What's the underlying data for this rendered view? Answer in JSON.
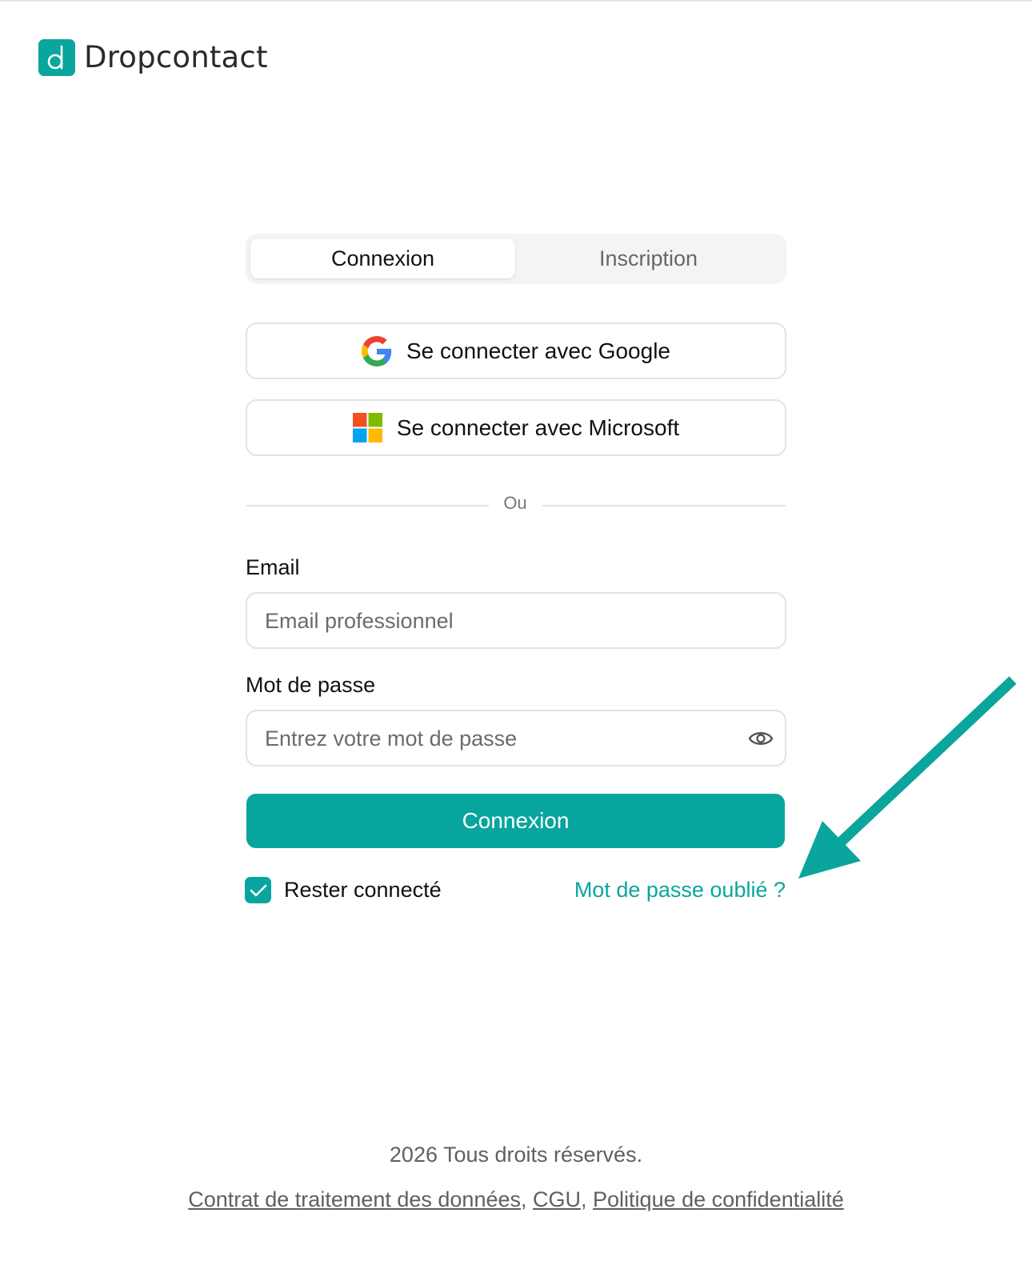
{
  "brand": {
    "name": "Dropcontact",
    "accent_color": "#07a59e",
    "logo_icon": "dropcontact-logo-icon"
  },
  "tabs": [
    {
      "label": "Connexion",
      "active": true
    },
    {
      "label": "Inscription",
      "active": false
    }
  ],
  "oauth": {
    "google": {
      "label": "Se connecter avec Google",
      "icon": "google-icon"
    },
    "microsoft": {
      "label": "Se connecter avec Microsoft",
      "icon": "microsoft-icon"
    }
  },
  "divider": {
    "text": "Ou"
  },
  "form": {
    "email": {
      "label": "Email",
      "placeholder": "Email professionnel",
      "value": ""
    },
    "password": {
      "label": "Mot de passe",
      "placeholder": "Entrez votre mot de passe",
      "value": "",
      "toggle_icon": "eye-icon"
    },
    "submit_label": "Connexion",
    "remember": {
      "label": "Rester connecté",
      "checked": true
    },
    "forgot_label": "Mot de passe oublié ?"
  },
  "annotation": {
    "icon": "arrow-icon",
    "color": "#0aa59c"
  },
  "footer": {
    "copyright": "2026 Tous droits réservés.",
    "links": [
      {
        "label": "Contrat de traitement des données"
      },
      {
        "label": "CGU"
      },
      {
        "label": "Politique de confidentialité"
      }
    ],
    "separator": ", "
  }
}
